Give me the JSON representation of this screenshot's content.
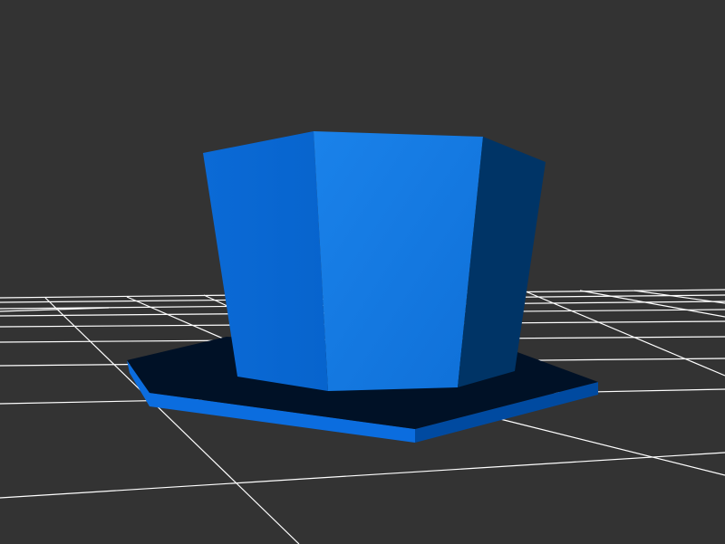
{
  "viewport": {
    "background_color": "#333333",
    "grid_color": "#ffffff"
  },
  "model": {
    "shape": "hexagonal-prism-on-hexagonal-base",
    "colors": {
      "face_front": "#1379e0",
      "face_left": "#0a6ad4",
      "face_right": "#003466",
      "base_shadow": "#001126",
      "base_edge_front": "#0b6ddf",
      "base_edge_right": "#004aa0"
    }
  }
}
